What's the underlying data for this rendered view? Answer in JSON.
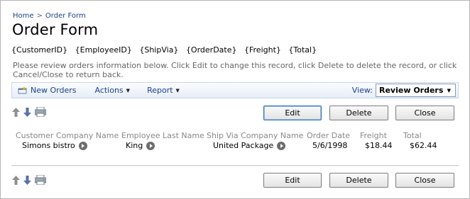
{
  "breadcrumb": {
    "home": "Home",
    "separator": ">",
    "current": "Order Form"
  },
  "page_title": "Order Form",
  "field_placeholders": [
    "{CustomerID}",
    "{EmployeeID}",
    "{ShipVia}",
    "{OrderDate}",
    "{Freight}",
    "{Total}"
  ],
  "instructions": "Please review orders information below. Click Edit to change this record, click Delete to delete the record, or click Cancel/Close to return back.",
  "toolbar": {
    "new_label": "New Orders",
    "actions_label": "Actions",
    "report_label": "Report",
    "view_label": "View:",
    "view_value": "Review Orders"
  },
  "buttons": {
    "edit": "Edit",
    "delete": "Delete",
    "close": "Close"
  },
  "grid": {
    "columns": [
      "Customer Company Name",
      "Employee Last Name",
      "Ship Via Company Name",
      "Order Date",
      "Freight",
      "Total"
    ],
    "row": [
      "Simons bistro",
      "King",
      "United Package",
      "5/6/1998",
      "$18.44",
      "$62.44"
    ]
  },
  "icons": [
    "up-arrow-icon",
    "down-arrow-icon",
    "print-icon",
    "new-record-icon",
    "navigate-arrow-icon"
  ],
  "colors": {
    "link": "#1b3f8b",
    "header_text": "#888888",
    "toolbar_border": "#c9d6e6",
    "button_focus": "#2c6fb3"
  }
}
